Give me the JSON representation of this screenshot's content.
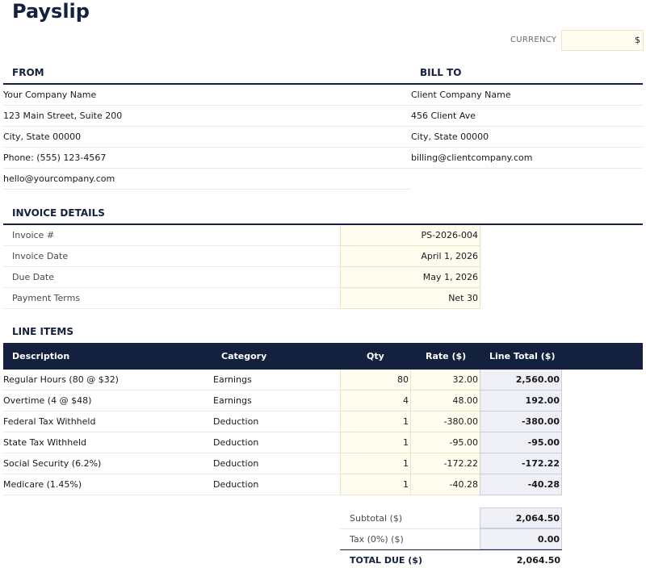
{
  "title": "Payslip",
  "currency": {
    "label": "CURRENCY",
    "value": "$"
  },
  "from": {
    "heading": "FROM",
    "lines": [
      "Your Company Name",
      "123 Main Street, Suite 200",
      "City, State 00000",
      "Phone: (555) 123-4567",
      "hello@yourcompany.com"
    ]
  },
  "bill_to": {
    "heading": "BILL TO",
    "lines": [
      "Client Company Name",
      "456 Client Ave",
      "City, State 00000",
      "billing@clientcompany.com"
    ]
  },
  "invoice_details": {
    "heading": "INVOICE DETAILS",
    "rows": [
      {
        "label": "Invoice #",
        "value": "PS-2026-004"
      },
      {
        "label": "Invoice Date",
        "value": "April 1, 2026"
      },
      {
        "label": "Due Date",
        "value": "May 1, 2026"
      },
      {
        "label": "Payment Terms",
        "value": "Net 30"
      }
    ]
  },
  "line_items": {
    "heading": "LINE ITEMS",
    "columns": {
      "description": "Description",
      "category": "Category",
      "qty": "Qty",
      "rate": "Rate ($)",
      "total": "Line Total ($)"
    },
    "rows": [
      {
        "description": "Regular Hours (80 @ $32)",
        "category": "Earnings",
        "qty": "80",
        "rate": "32.00",
        "total": "2,560.00"
      },
      {
        "description": "Overtime (4 @ $48)",
        "category": "Earnings",
        "qty": "4",
        "rate": "48.00",
        "total": "192.00"
      },
      {
        "description": "Federal Tax Withheld",
        "category": "Deduction",
        "qty": "1",
        "rate": "-380.00",
        "total": "-380.00"
      },
      {
        "description": "State Tax Withheld",
        "category": "Deduction",
        "qty": "1",
        "rate": "-95.00",
        "total": "-95.00"
      },
      {
        "description": "Social Security (6.2%)",
        "category": "Deduction",
        "qty": "1",
        "rate": "-172.22",
        "total": "-172.22"
      },
      {
        "description": "Medicare (1.45%)",
        "category": "Deduction",
        "qty": "1",
        "rate": "-40.28",
        "total": "-40.28"
      }
    ]
  },
  "summary": {
    "subtotal_label": "Subtotal ($)",
    "subtotal_value": "2,064.50",
    "tax_label": "Tax (0%) ($)",
    "tax_value": "0.00",
    "total_label": "TOTAL DUE ($)",
    "total_value": "2,064.50"
  }
}
